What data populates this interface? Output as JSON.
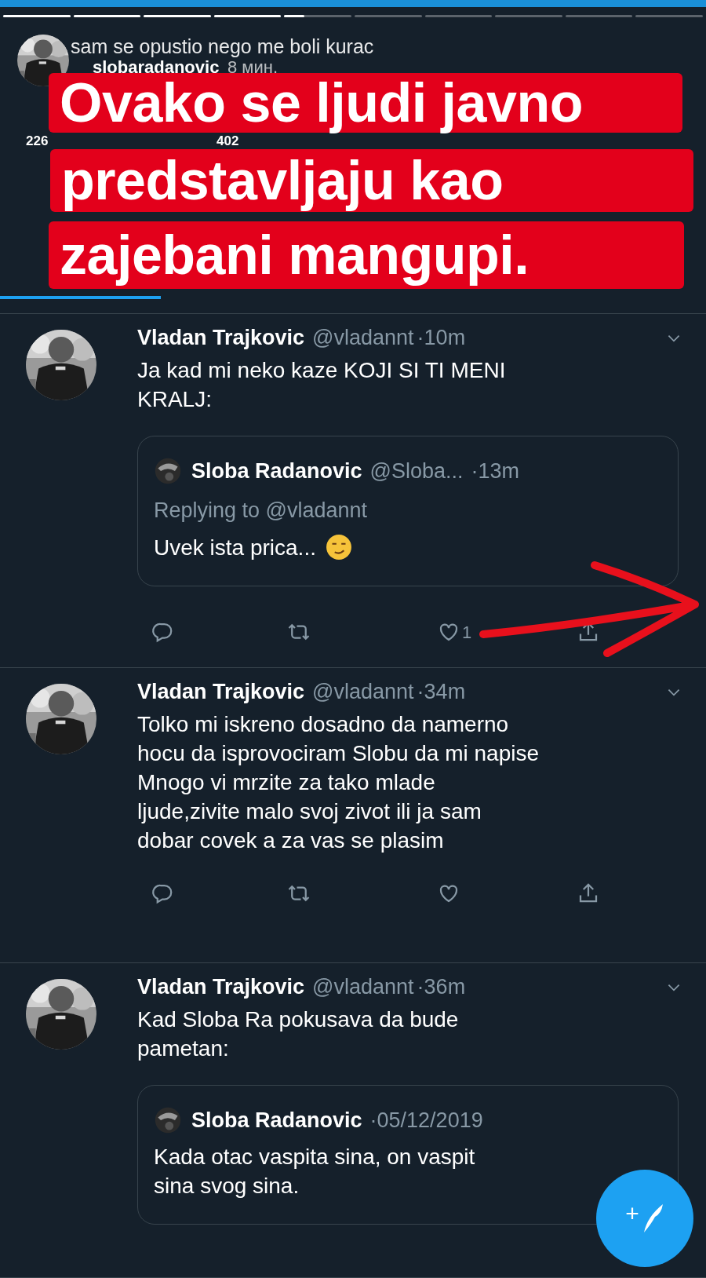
{
  "story": {
    "segments": [
      {
        "level": 1
      },
      {
        "level": 1
      },
      {
        "level": 1
      },
      {
        "level": 1
      },
      {
        "level": 0.3
      },
      {
        "level": 0
      },
      {
        "level": 0
      },
      {
        "level": 0
      },
      {
        "level": 0
      },
      {
        "level": 0
      }
    ],
    "caption": "sam se opustio nego me boli kurac",
    "username": "slobaradanovic",
    "time": "8 мин.",
    "overlay_lines": [
      "Ovako se ljudi javno",
      "predstavljaju kao",
      "zajebani mangupi."
    ]
  },
  "profile": {
    "following_count": "226",
    "followers_count": "402"
  },
  "tweets": [
    {
      "name": "Vladan Trajkovic",
      "handle": "@vladannt",
      "time": "·10m",
      "text": "Ja kad mi neko kaze KOJI SI TI MENI\nKRALJ:",
      "like_count": "1",
      "annotated": true,
      "quote": {
        "name": "Sloba Radanovic",
        "handle": "@Sloba...",
        "time": "·13m",
        "replying_to": "Replying to @vladannt",
        "text": "Uvek ista prica...",
        "emoji": true
      }
    },
    {
      "name": "Vladan Trajkovic",
      "handle": "@vladannt",
      "time": "·34m",
      "text": "Tolko mi iskreno dosadno da namerno\nhocu da isprovociram Slobu da mi napise\nMnogo vi mrzite za tako mlade\nljude,zivite malo svoj zivot ili ja sam\ndobar covek a za vas se plasim",
      "annotated": false
    },
    {
      "name": "Vladan Trajkovic",
      "handle": "@vladannt",
      "time": "·36m",
      "text": "Kad Sloba Ra pokusava da bude\npametan:",
      "annotated": false,
      "quote": {
        "name": "Sloba Radanovic",
        "time": "·05/12/2019",
        "text": "Kada otac vaspita sina, on vaspit\nsina svog sina.",
        "emoji": false
      }
    }
  ],
  "compose_button": {
    "label": "+"
  }
}
